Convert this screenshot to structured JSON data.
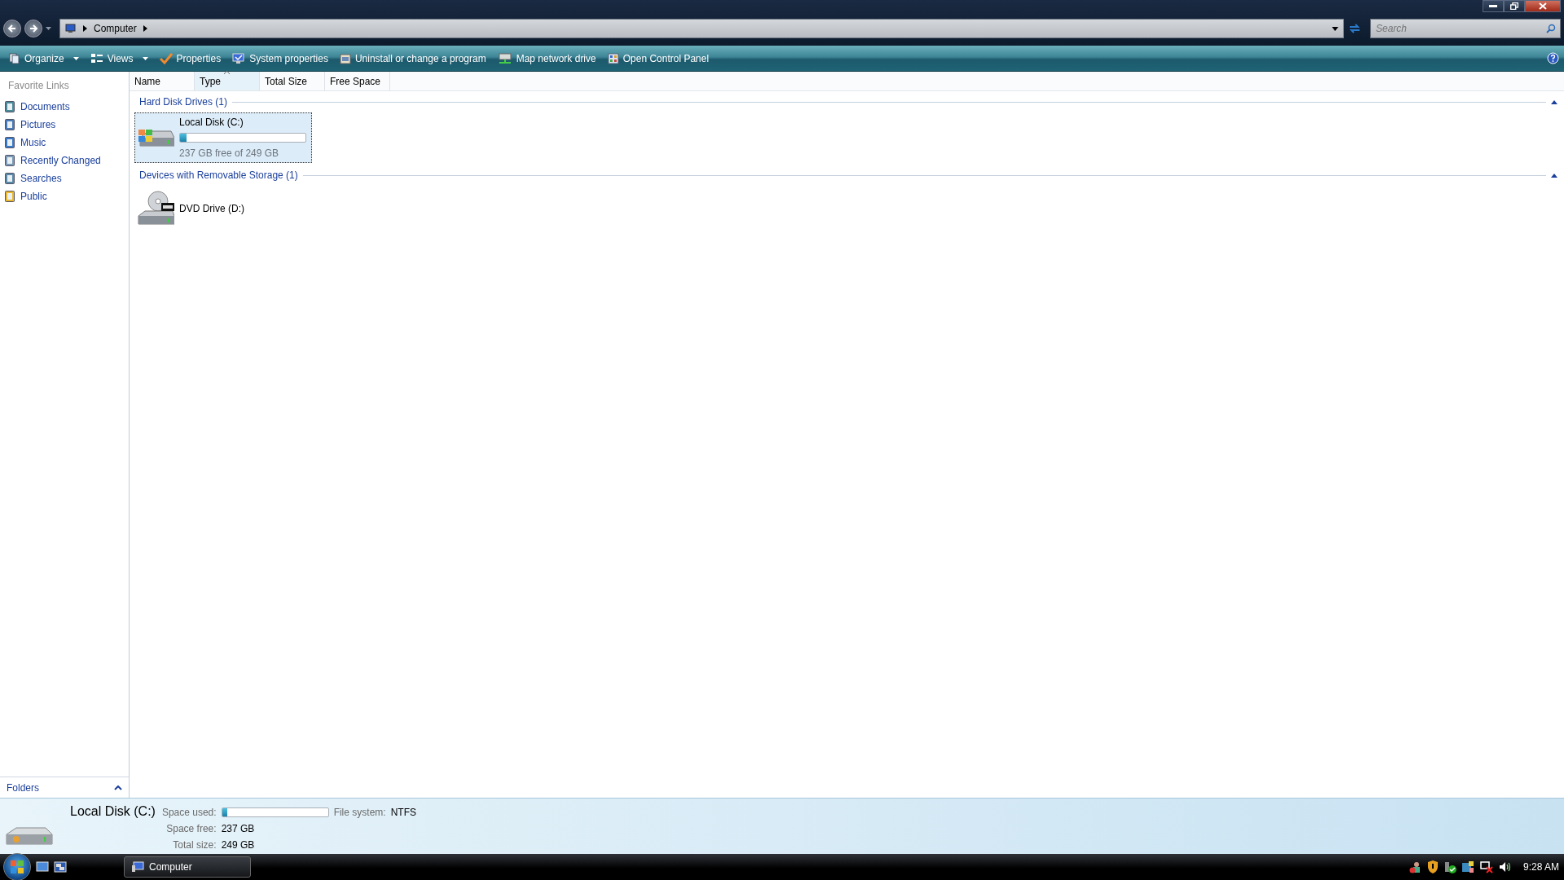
{
  "address": {
    "crumbs": [
      "Computer"
    ]
  },
  "search": {
    "placeholder": "Search"
  },
  "toolbar": [
    {
      "label": "Organize",
      "dropdown": true
    },
    {
      "label": "Views",
      "dropdown": true
    },
    {
      "label": "Properties",
      "dropdown": false
    },
    {
      "label": "System properties",
      "dropdown": false
    },
    {
      "label": "Uninstall or change a program",
      "dropdown": false
    },
    {
      "label": "Map network drive",
      "dropdown": false
    },
    {
      "label": "Open Control Panel",
      "dropdown": false
    }
  ],
  "sidebar": {
    "title": "Favorite Links",
    "items": [
      {
        "label": "Documents"
      },
      {
        "label": "Pictures"
      },
      {
        "label": "Music"
      },
      {
        "label": "Recently Changed"
      },
      {
        "label": "Searches"
      },
      {
        "label": "Public"
      }
    ],
    "folders": {
      "label": "Folders",
      "expanded": false
    }
  },
  "columns": [
    {
      "label": "Name",
      "sorted": false
    },
    {
      "label": "Type",
      "sorted": true
    },
    {
      "label": "Total Size",
      "sorted": false
    },
    {
      "label": "Free Space",
      "sorted": false
    }
  ],
  "groups": [
    {
      "title": "Hard Disk Drives (1)",
      "items": [
        {
          "kind": "disk",
          "name": "Local Disk (C:)",
          "level": 0.05,
          "free": "237 GB free of 249 GB",
          "selected": true
        }
      ]
    },
    {
      "title": "Devices with Removable Storage (1)",
      "items": [
        {
          "kind": "dvd",
          "name": "DVD Drive (D:)",
          "selected": false
        }
      ]
    }
  ],
  "details": {
    "name": "Local Disk (C:)",
    "fields": [
      {
        "label": "Space used:",
        "kind": "bar",
        "level": 0.05
      },
      {
        "label": "Space free:",
        "kind": "text",
        "value": "237 GB"
      },
      {
        "label": "Total size:",
        "kind": "text",
        "value": "249 GB"
      },
      {
        "label": "File system:",
        "kind": "text",
        "value": "NTFS"
      }
    ]
  },
  "taskbar": {
    "tasks": [
      {
        "label": "Computer"
      }
    ],
    "clock": "9:28 AM"
  }
}
